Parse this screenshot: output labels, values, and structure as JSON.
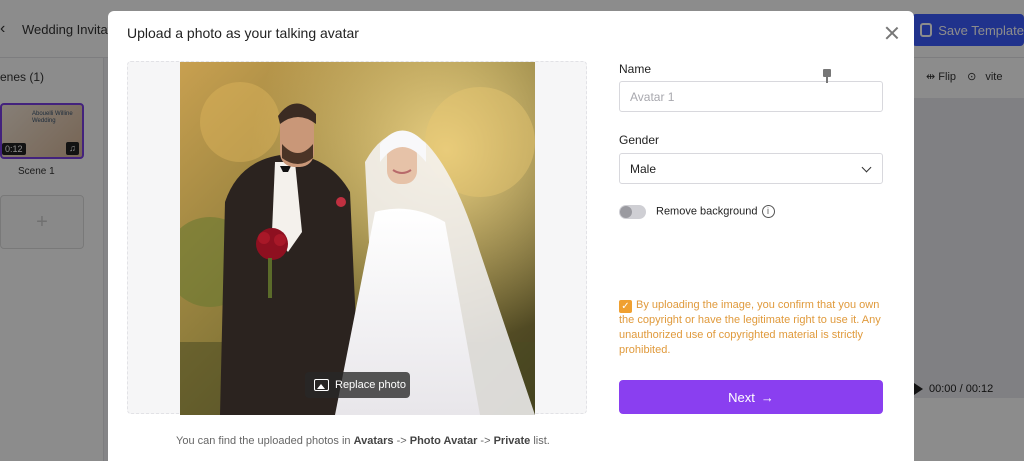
{
  "background": {
    "back_glyph": "‹",
    "project_title": "Wedding Invitati",
    "save_label": "Save Template",
    "scenes_header": "enes (1)",
    "thumb_text": "Abouelli Willine Wedding",
    "thumb_duration": "0:12",
    "scene_label": "Scene 1",
    "flip_label": "Flip",
    "more_label": "vite",
    "player_time": "00:00 / 00:12"
  },
  "modal": {
    "title": "Upload a photo as your talking avatar",
    "replace_photo_label": "Replace photo",
    "footnote": {
      "prefix": "You can find the uploaded photos in ",
      "part1": "Avatars",
      "sep1": " -> ",
      "part2": "Photo Avatar",
      "sep2": " -> ",
      "part3": "Private",
      "suffix": " list."
    },
    "name_label": "Name",
    "name_placeholder": "Avatar 1",
    "name_value": "",
    "gender_label": "Gender",
    "gender_value": "Male",
    "remove_bg_label": "Remove background",
    "remove_bg_enabled": false,
    "consent_checked": true,
    "consent_text": "By uploading the image, you confirm that you own the copyright or have the legitimate right to use it. Any unauthorized use of copyrighted material is strictly prohibited.",
    "next_label": "Next",
    "next_arrow": "→"
  },
  "colors": {
    "accent": "#8a3ff0",
    "save_button": "#3b5bff",
    "consent": "#e09a3c"
  }
}
